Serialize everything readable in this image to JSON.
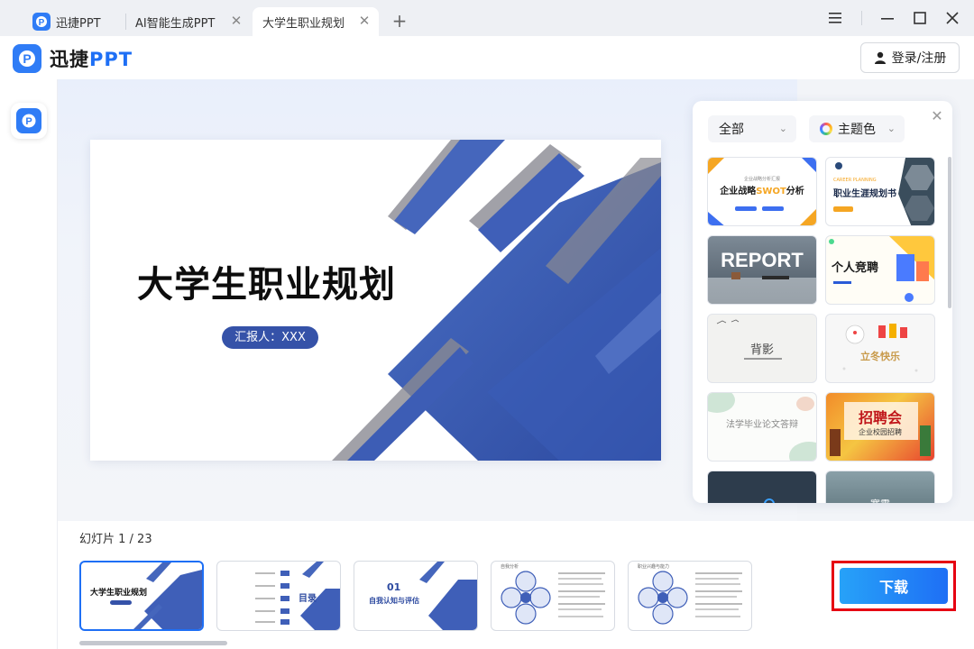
{
  "tabs": [
    {
      "label": "迅捷PPT",
      "active": false,
      "has_icon": true
    },
    {
      "label": "AI智能生成PPT",
      "active": false,
      "closable": true
    },
    {
      "label": "大学生职业规划",
      "active": true,
      "closable": true
    }
  ],
  "tab_icons": {
    "close": "close-icon",
    "new_tab": "plus-icon"
  },
  "window_controls": [
    "menu-icon",
    "minimize-icon",
    "maximize-icon",
    "close-icon"
  ],
  "app": {
    "brand_prefix": "迅捷",
    "brand_suffix": "PPT",
    "login_label": "登录/注册",
    "login_icon": "user-icon"
  },
  "slide": {
    "title": "大学生职业规划",
    "reporter": "汇报人：XXX"
  },
  "template_panel": {
    "filter_all": "全部",
    "filter_theme": "主题色",
    "close_icon": "close-icon",
    "templates": [
      {
        "title": "企业战略",
        "highlight": "SWOT",
        "suffix": "分析",
        "subtitle": "企业战略分析汇报"
      },
      {
        "title": "职业生涯规划书",
        "subtitle": "CAREER PLANNING"
      },
      {
        "title": "REPORT"
      },
      {
        "title": "个人竞聘"
      },
      {
        "title": "背影"
      },
      {
        "title": "立冬快乐"
      },
      {
        "title": "法学毕业论文答辩"
      },
      {
        "title": "招聘会",
        "subtitle": "企业校园招聘"
      },
      {
        "title": ""
      },
      {
        "title": "寒露"
      }
    ]
  },
  "footer": {
    "slide_counter": "幻灯片 1 / 23",
    "download_label": "下载"
  },
  "thumbnails": [
    {
      "title": "大学生职业规划",
      "subtitle": "汇报人：XXX"
    },
    {
      "title": "目录"
    },
    {
      "title": "01",
      "subtitle": "自我认知与评估"
    },
    {
      "title": "自我分析"
    },
    {
      "title": "职业兴趣与能力"
    }
  ],
  "colors": {
    "accent": "#1e6ff5",
    "slide_blue": "#3552a8",
    "download_outline": "#e60012"
  }
}
